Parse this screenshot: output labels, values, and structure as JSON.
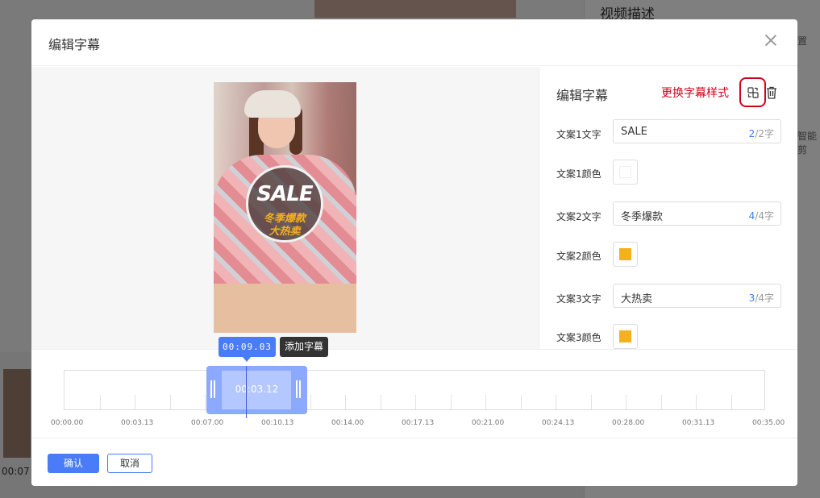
{
  "background": {
    "title": "视频描述",
    "right_cut_1": "置",
    "right_cut_2": "智能剪",
    "strip_time": "00:07"
  },
  "modal": {
    "title": "编辑字幕",
    "close_icon": "close-icon"
  },
  "preview": {
    "subtitle_1": "SALE",
    "subtitle_2": "冬季爆款",
    "subtitle_3": "大热卖"
  },
  "edit_panel": {
    "title": "编辑字幕",
    "change_style_label": "更换字幕样式",
    "change_style_icon": "swap-style-icon",
    "delete_icon": "trash-icon",
    "rows": [
      {
        "type": "text",
        "label": "文案1文字",
        "value": "SALE",
        "count_current": "2",
        "count_rest": "/2字"
      },
      {
        "type": "color",
        "label": "文案1颜色",
        "color": "#ffffff"
      },
      {
        "type": "text",
        "label": "文案2文字",
        "value": "冬季爆款",
        "count_current": "4",
        "count_rest": "/4字"
      },
      {
        "type": "color",
        "label": "文案2颜色",
        "color": "#f5b11c"
      },
      {
        "type": "text",
        "label": "文案3文字",
        "value": "大热卖",
        "count_current": "3",
        "count_rest": "/4字"
      },
      {
        "type": "color",
        "label": "文案3颜色",
        "color": "#f5b11c"
      }
    ]
  },
  "timeline": {
    "cursor_time": "00:09.03",
    "add_subtitle_label": "添加字幕",
    "clip_time": "00:03.12",
    "tick_labels": [
      "00:00.00",
      "00:03.13",
      "00:07.00",
      "00:10.13",
      "00:14.00",
      "00:17.13",
      "00:21.00",
      "00:24.13",
      "00:28.00",
      "00:31.13",
      "00:35.00"
    ]
  },
  "footer": {
    "ok_label": "确认",
    "cancel_label": "取消"
  },
  "colors": {
    "accent": "#4a7cf7",
    "highlight_red": "#d0021b"
  }
}
